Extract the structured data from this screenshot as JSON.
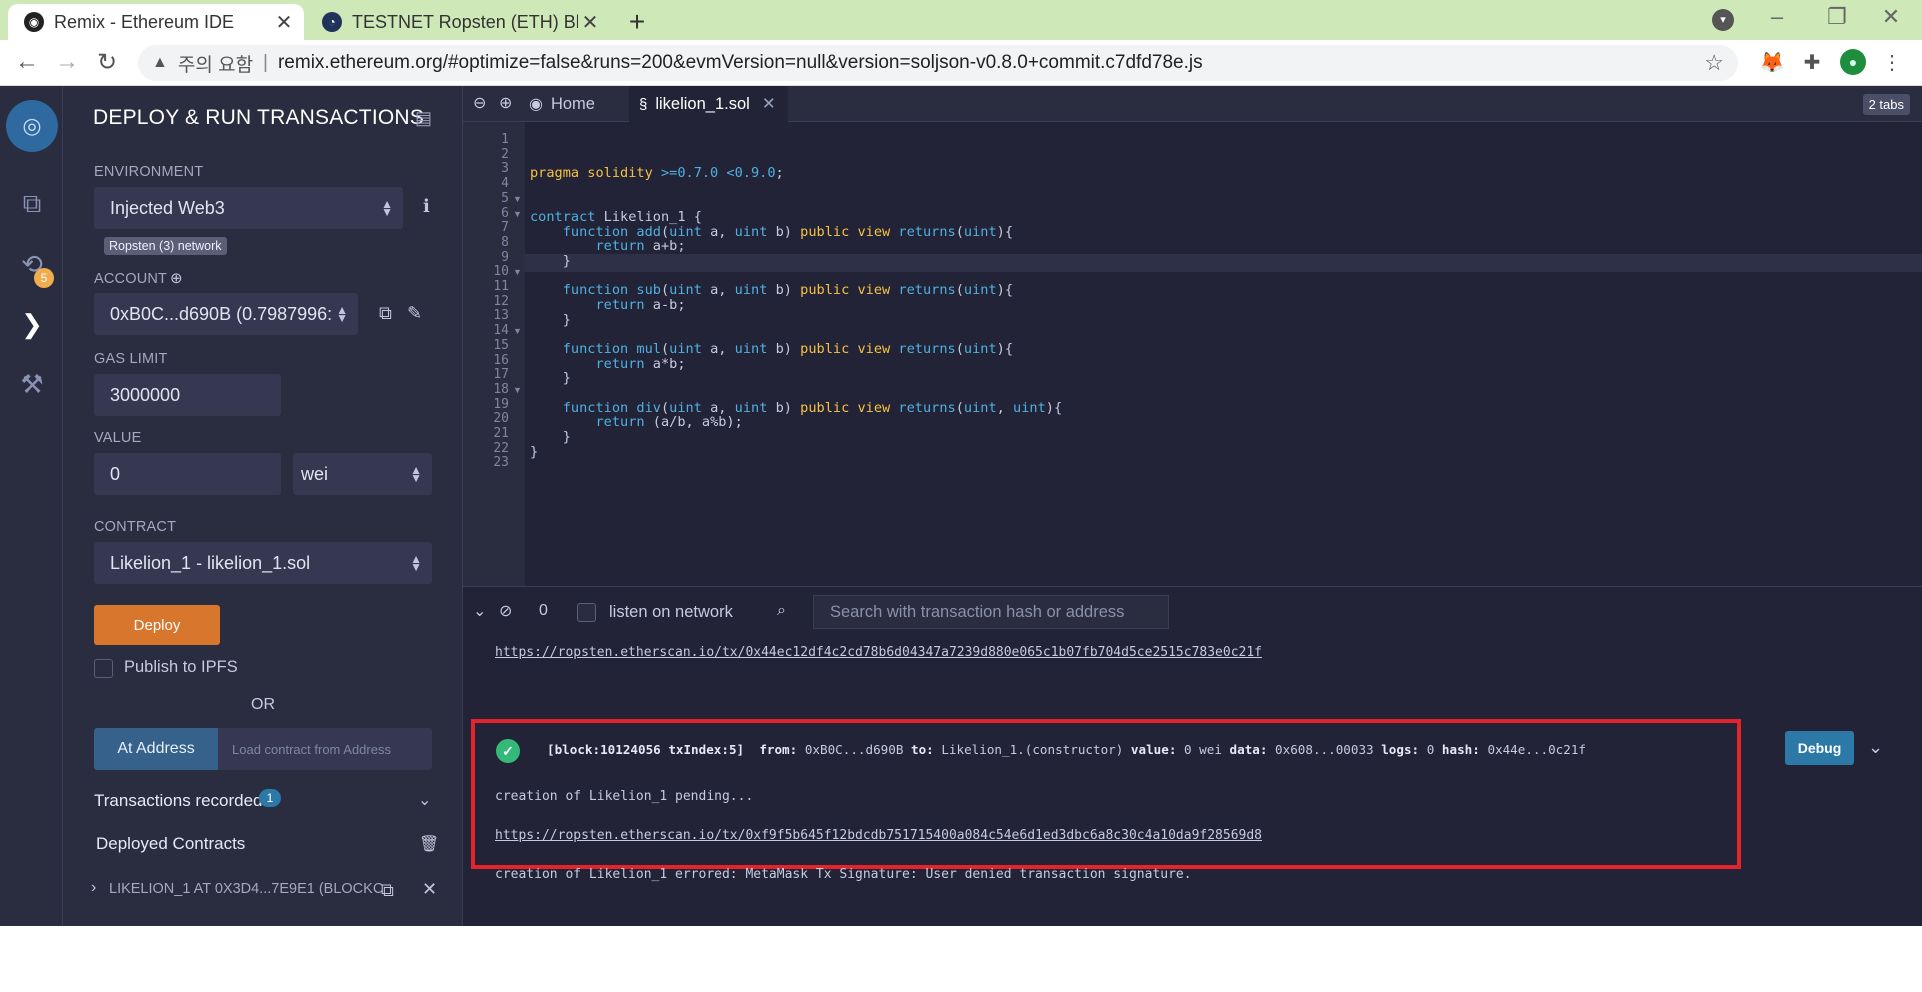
{
  "browser": {
    "tabs": [
      {
        "title": "Remix - Ethereum IDE",
        "active": true
      },
      {
        "title": "TESTNET Ropsten (ETH) Blockch",
        "active": false
      }
    ],
    "security_warning": "주의 요함",
    "url": "remix.ethereum.org/#optimize=false&runs=200&evmVersion=null&version=soljson-v0.8.0+commit.c7dfd78e.js"
  },
  "iconbar": {
    "plugin_badge": "5"
  },
  "panel": {
    "title": "DEPLOY & RUN TRANSACTIONS",
    "environment_label": "ENVIRONMENT",
    "environment_value": "Injected Web3",
    "network_badge": "Ropsten (3) network",
    "account_label": "ACCOUNT",
    "account_value": "0xB0C...d690B (0.7987996:",
    "gas_limit_label": "GAS LIMIT",
    "gas_limit_value": "3000000",
    "value_label": "VALUE",
    "value_amount": "0",
    "value_unit": "wei",
    "contract_label": "CONTRACT",
    "contract_value": "Likelion_1 - likelion_1.sol",
    "deploy_button": "Deploy",
    "publish_label": "Publish to IPFS",
    "or_label": "OR",
    "at_address_button": "At Address",
    "at_address_placeholder": "Load contract from Address",
    "transactions_recorded_label": "Transactions recorded",
    "transactions_recorded_count": "1",
    "deployed_contracts_label": "Deployed Contracts",
    "deployed_item": "LIKELION_1 AT 0X3D4...7E9E1 (BLOCKC"
  },
  "editor": {
    "tabs": [
      {
        "label": "Home",
        "active": false
      },
      {
        "label": "likelion_1.sol",
        "active": true
      }
    ],
    "tabs_count": "2 tabs",
    "line_numbers": [
      "1",
      "2",
      "3",
      "4",
      "5",
      "6",
      "7",
      "8",
      "9",
      "10",
      "11",
      "12",
      "13",
      "14",
      "15",
      "16",
      "17",
      "18",
      "19",
      "20",
      "21",
      "22",
      "23"
    ]
  },
  "terminal": {
    "pending_count": "0",
    "listen_label": "listen on network",
    "search_placeholder": "Search with transaction hash or address",
    "link1": "https://ropsten.etherscan.io/tx/0x44ec12df4c2cd78b6d04347a7239d880e065c1b07fb704d5ce2515c783e0c21f",
    "tx_block": "[block:10124056 txIndex:5]",
    "tx_from_label": "from:",
    "tx_from": "0xB0C...d690B",
    "tx_to_label": "to:",
    "tx_to": "Likelion_1.(constructor)",
    "tx_value_label": "value:",
    "tx_value": "0 wei",
    "tx_data_label": "data:",
    "tx_data": "0x608...00033",
    "tx_logs_label": "logs:",
    "tx_logs": "0",
    "tx_hash_label": "hash:",
    "tx_hash": "0x44e...0c21f",
    "debug_button": "Debug",
    "pending_message": "creation of Likelion_1 pending...",
    "link2": "https://ropsten.etherscan.io/tx/0xf9f5b645f12bdcdb751715400a084c54e6d1ed3dbc6a8c30c4a10da9f28569d8",
    "error_message": "creation of Likelion_1 errored: MetaMask Tx Signature: User denied transaction signature."
  }
}
